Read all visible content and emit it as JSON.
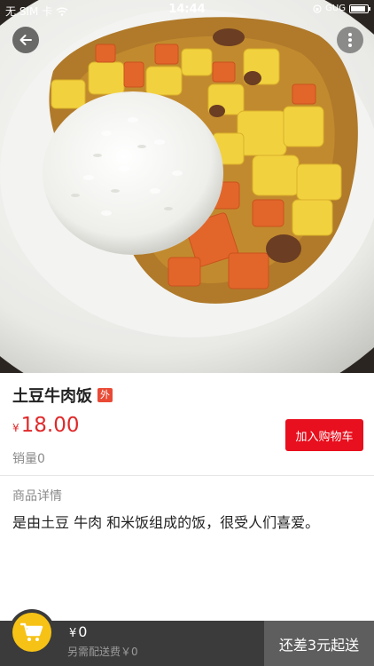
{
  "status_bar": {
    "carrier": "无 SIM 卡",
    "time": "14:44",
    "battery_text": "GUG"
  },
  "product": {
    "name": "土豆牛肉饭",
    "badge": "外",
    "price_symbol": "¥",
    "price": "18.00",
    "sales": "销量0",
    "add_to_cart": "加入购物车"
  },
  "details": {
    "label": "商品详情",
    "description": "是由土豆 牛肉 和米饭组成的饭，很受人们喜爱。"
  },
  "cart": {
    "total_symbol": "¥",
    "total": "0",
    "delivery_fee": "另需配送费￥0",
    "checkout_label": "还差3元起送"
  },
  "colors": {
    "price": "#e0292a",
    "add_cart_button": "#e80f1e",
    "cart_icon_bg": "#f6c215",
    "cart_bar": "#3b3b3b",
    "checkout_bg": "#5e5e5e"
  },
  "icons": {
    "back": "arrow-left-icon",
    "more": "vertical-dots-icon",
    "cart": "shopping-cart-icon"
  }
}
